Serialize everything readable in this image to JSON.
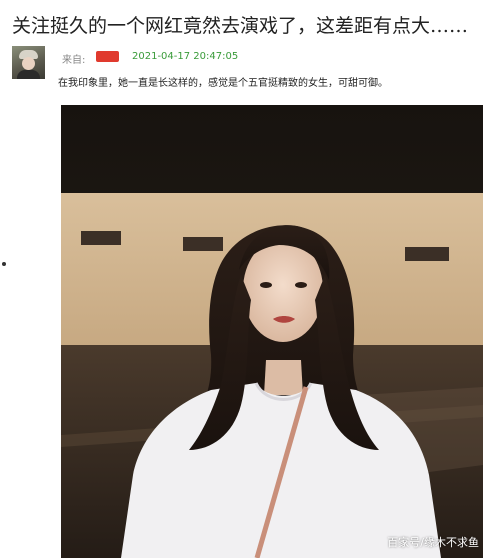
{
  "post": {
    "title": "关注挺久的一个网红竟然去演戏了，这差距有点大……",
    "source_label": "来自:",
    "timestamp": "2021-04-17 20:47:05",
    "comment": "在我印象里，她一直是长这样的，感觉是个五官挺精致的女生，可甜可御。"
  },
  "image": {
    "watermark": "百家号/缘木不求鱼"
  },
  "colors": {
    "timestamp": "#3a9b3a",
    "redaction": "#e03a2e",
    "title": "#222222"
  }
}
